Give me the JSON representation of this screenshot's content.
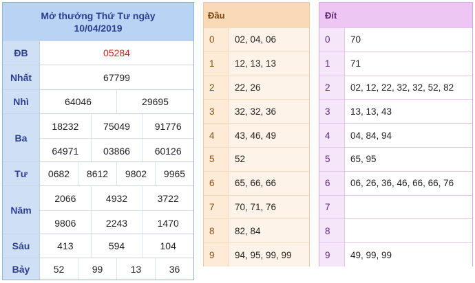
{
  "header": {
    "title_line1": "Mở thưởng Thứ Tư ngày",
    "title_line2": "10/04/2019"
  },
  "prizes": {
    "db": {
      "label": "ĐB",
      "values": [
        "05284"
      ]
    },
    "nhat": {
      "label": "Nhất",
      "values": [
        "67799"
      ]
    },
    "nhi": {
      "label": "Nhì",
      "values": [
        "64046",
        "29695"
      ]
    },
    "ba": {
      "label": "Ba",
      "values": [
        "18232",
        "75049",
        "91776",
        "64971",
        "03866",
        "60126"
      ]
    },
    "tu": {
      "label": "Tư",
      "values": [
        "0682",
        "8612",
        "9802",
        "9965"
      ]
    },
    "nam": {
      "label": "Năm",
      "values": [
        "2066",
        "4932",
        "3722",
        "9806",
        "2243",
        "1470"
      ]
    },
    "sau": {
      "label": "Sáu",
      "values": [
        "413",
        "594",
        "104"
      ]
    },
    "bay": {
      "label": "Bảy",
      "values": [
        "52",
        "99",
        "13",
        "36"
      ]
    }
  },
  "dau": {
    "header": "Đầu",
    "rows": [
      {
        "k": "0",
        "v": "02, 04, 06"
      },
      {
        "k": "1",
        "v": "12, 13, 13"
      },
      {
        "k": "2",
        "v": "22, 26"
      },
      {
        "k": "3",
        "v": "32, 32, 36"
      },
      {
        "k": "4",
        "v": "43, 46, 49"
      },
      {
        "k": "5",
        "v": "52"
      },
      {
        "k": "6",
        "v": "65, 66, 66"
      },
      {
        "k": "7",
        "v": "70, 71, 76"
      },
      {
        "k": "8",
        "v": "82, 84"
      },
      {
        "k": "9",
        "v": "94, 95, 99, 99"
      }
    ]
  },
  "dit": {
    "header": "Đít",
    "rows": [
      {
        "k": "0",
        "v": "70"
      },
      {
        "k": "1",
        "v": "71"
      },
      {
        "k": "2",
        "v": "02, 12, 22, 32, 32, 52, 82"
      },
      {
        "k": "3",
        "v": "13, 13, 43"
      },
      {
        "k": "4",
        "v": "04, 84, 94"
      },
      {
        "k": "5",
        "v": "65, 95"
      },
      {
        "k": "6",
        "v": "06, 26, 36, 46, 66, 66, 76"
      },
      {
        "k": "7",
        "v": ""
      },
      {
        "k": "8",
        "v": ""
      },
      {
        "k": "9",
        "v": "49, 99, 99"
      }
    ]
  }
}
